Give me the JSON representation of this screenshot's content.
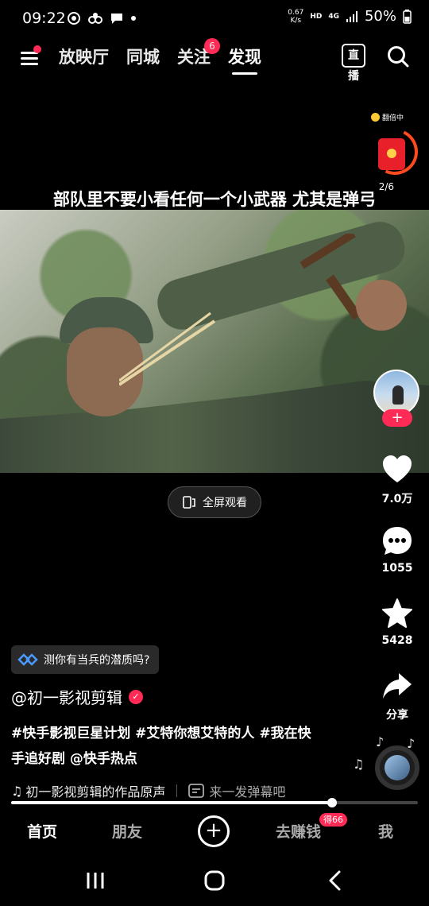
{
  "status_bar": {
    "time": "09:22",
    "net_speed_value": "0.67",
    "net_speed_unit": "K/s",
    "hd": "HD",
    "network": "4G",
    "battery": "50%"
  },
  "top_nav": {
    "tabs": [
      {
        "label": "放映厅"
      },
      {
        "label": "同城"
      },
      {
        "label": "关注",
        "badge": "6"
      },
      {
        "label": "发现",
        "active": true
      }
    ],
    "live_label": "直播"
  },
  "reward": {
    "label": "翻倍中"
  },
  "video": {
    "page_counter": "2/6",
    "subtitle": "部队里不要小看任何一个小武器 尤其是弹弓",
    "fullscreen_label": "全屏观看",
    "progress_fraction": 0.79
  },
  "side_actions": {
    "follow_label": "+",
    "likes": "7.0万",
    "comments": "1055",
    "favorites": "5428",
    "share": "分享"
  },
  "info": {
    "test_banner": "测你有当兵的潜质吗?",
    "author": "@初一影视剪辑",
    "description_line1": "#快手影视巨星计划 #艾特你想艾特的人 #我在快",
    "description_line2": "手追好剧 @快手热点",
    "music": "初一影视剪辑的作品原声",
    "danmu": "来一发弹幕吧"
  },
  "bottom_nav": {
    "home": "首页",
    "friends": "朋友",
    "plus": "+",
    "earn": "去赚钱",
    "earn_badge": "得66",
    "me": "我"
  },
  "colors": {
    "accent": "#ff2a55",
    "background": "#000000"
  }
}
